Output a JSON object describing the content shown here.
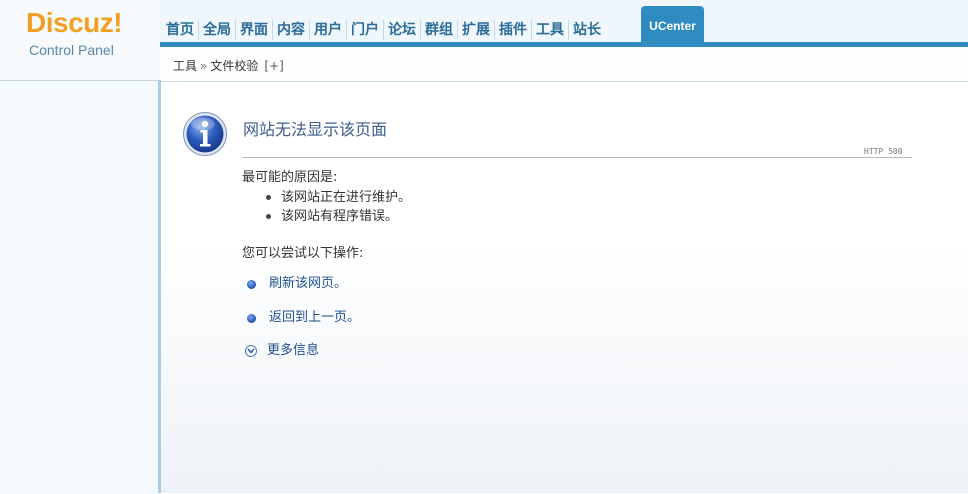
{
  "logo": {
    "brand": "Discuz!",
    "subtitle": "Control Panel"
  },
  "nav": {
    "items": [
      "首页",
      "全局",
      "界面",
      "内容",
      "用户",
      "门户",
      "论坛",
      "群组",
      "扩展",
      "插件",
      "工具",
      "站长"
    ],
    "active": "UCenter"
  },
  "breadcrumb": {
    "section": "工具",
    "separator": "»",
    "page": "文件校验",
    "add": "[+]"
  },
  "error": {
    "title": "网站无法显示该页面",
    "code": "HTTP 500",
    "reason_title": "最可能的原因是:",
    "reasons": [
      "该网站正在进行维护。",
      "该网站有程序错误。"
    ],
    "try_title": "您可以尝试以下操作:",
    "actions": {
      "refresh": "刷新该网页。",
      "back": "返回到上一页。",
      "more": "更多信息"
    }
  },
  "colors": {
    "accent": "#2f8bc0",
    "logo": "#f2a023",
    "link": "#1f4f90"
  },
  "icons": {
    "error_icon": "info-icon",
    "bullet": "blue-bullet-icon",
    "expand": "chevron-down-circle-icon"
  }
}
